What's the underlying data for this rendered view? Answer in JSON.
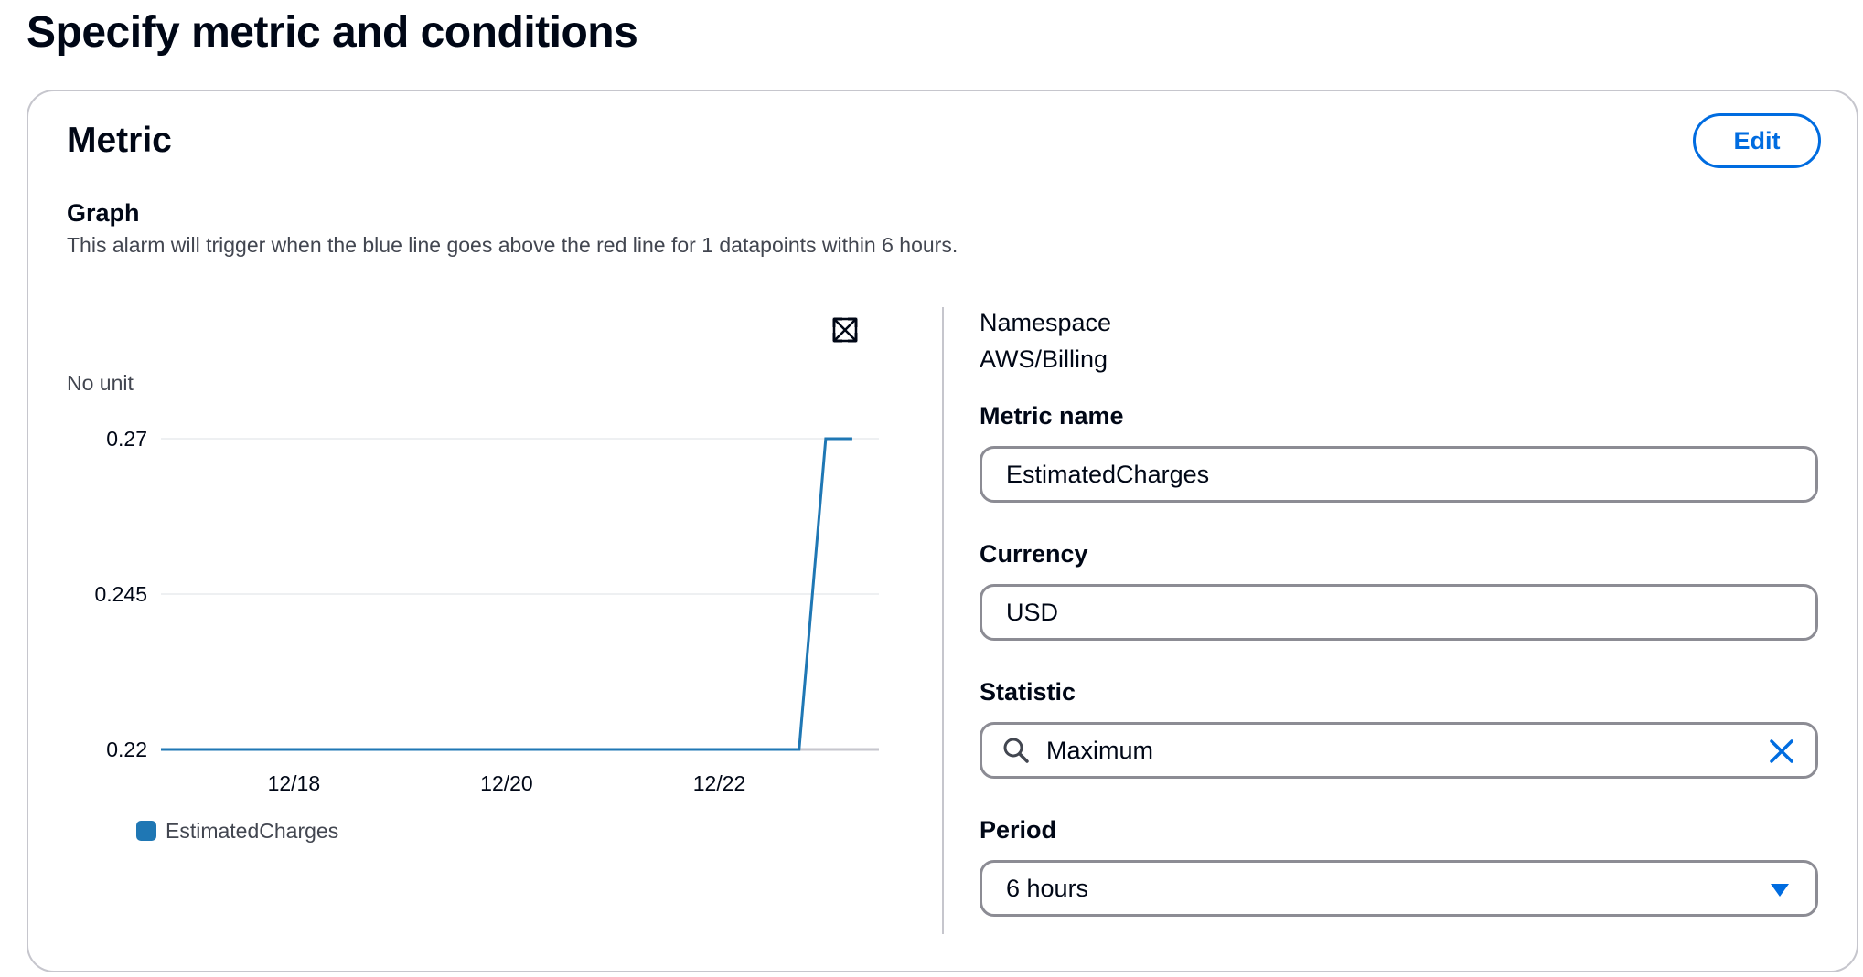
{
  "page": {
    "title": "Specify metric and conditions"
  },
  "metric_panel": {
    "title": "Metric",
    "edit_label": "Edit",
    "graph": {
      "heading": "Graph",
      "description": "This alarm will trigger when the blue line goes above the red line for 1 datapoints within 6 hours.",
      "expand_icon": "expand-icon"
    },
    "namespace": {
      "label": "Namespace",
      "value": "AWS/Billing"
    },
    "fields": {
      "metric_name": {
        "label": "Metric name",
        "value": "EstimatedCharges"
      },
      "currency": {
        "label": "Currency",
        "value": "USD"
      },
      "statistic": {
        "label": "Statistic",
        "value": "Maximum",
        "icon": "search-icon",
        "clear_icon": "close-icon"
      },
      "period": {
        "label": "Period",
        "value": "6 hours",
        "icon": "caret-down-icon"
      }
    },
    "colors": {
      "accent": "#006ce0",
      "series": "#1f77b4",
      "border": "#8c8c94"
    }
  },
  "chart_data": {
    "type": "line",
    "ylabel": "No unit",
    "ylim": [
      0.22,
      0.27
    ],
    "yticks": [
      "0.27",
      "0.245",
      "0.22"
    ],
    "xticks": [
      "12/18",
      "12/20",
      "12/22"
    ],
    "xlim": [
      "12/16 18:00",
      "12/23 12:00"
    ],
    "grid": true,
    "legend_position": "bottom-left",
    "series": [
      {
        "name": "EstimatedCharges",
        "color": "#1f77b4",
        "x": [
          "12/16 18:00",
          "12/22 18:00",
          "12/23 00:00",
          "12/23 06:00"
        ],
        "y": [
          0.22,
          0.22,
          0.27,
          0.27
        ]
      }
    ]
  }
}
